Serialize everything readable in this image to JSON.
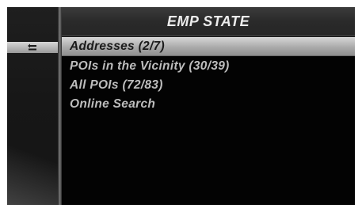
{
  "header": {
    "title": "EMP STATE"
  },
  "sidebar": {
    "back_icon": "back-arrow-icon"
  },
  "menu": {
    "items": [
      {
        "label": "Addresses  (2/7)",
        "selected": true
      },
      {
        "label": "POIs in the Vicinity  (30/39)",
        "selected": false
      },
      {
        "label": "All POIs  (72/83)",
        "selected": false
      },
      {
        "label": "Online Search",
        "selected": false
      }
    ]
  },
  "colors": {
    "screen_bg": "#030303",
    "selected_bg": "#b8b8b8",
    "text": "#bdbdbd"
  }
}
